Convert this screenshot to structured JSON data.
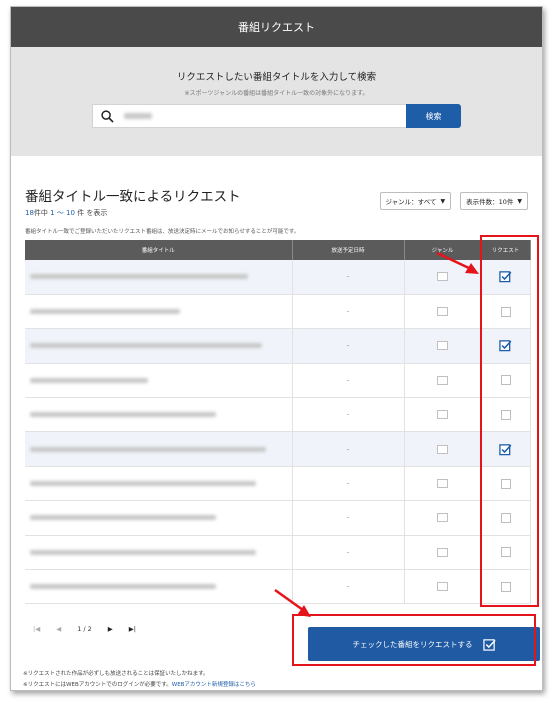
{
  "header": {
    "title": "番組リクエスト"
  },
  "search": {
    "title": "リクエストしたい番組タイトルを入力して検索",
    "note": "※スポーツジャンルの番組は番組タイトル一致の対象外になります。",
    "button_label": "検索"
  },
  "main": {
    "heading": "番組タイトル一致によるリクエスト",
    "count_total": "18",
    "count_suffix": "件中",
    "count_range": "1 〜 10",
    "count_end": "件 を表示",
    "description": "番組タイトル一致でご登録いただいたリクエスト番組は、放送決定時にメールでお知らせすることが可能です。",
    "filter_genre": "ジャンル：すべて",
    "filter_count": "表示件数：10件"
  },
  "table": {
    "columns": [
      "番組タイトル",
      "放送予定日時",
      "ジャンル",
      "リクエスト"
    ],
    "rows": [
      {
        "date": "-",
        "checked": true
      },
      {
        "date": "-",
        "checked": false
      },
      {
        "date": "-",
        "checked": true
      },
      {
        "date": "-",
        "checked": false
      },
      {
        "date": "-",
        "checked": false
      },
      {
        "date": "-",
        "checked": true
      },
      {
        "date": "-",
        "checked": false
      },
      {
        "date": "-",
        "checked": false
      },
      {
        "date": "-",
        "checked": false
      },
      {
        "date": "-",
        "checked": false
      }
    ]
  },
  "pager": {
    "first": "|◀",
    "prev": "◀",
    "page": "1 / 2",
    "next": "▶",
    "last": "▶|"
  },
  "submit": {
    "label": "チェックした番組をリクエストする"
  },
  "notes": {
    "line1": "※リクエストされた作品が必ずしも放送されることは保証いたしかねます。",
    "line2": "※リクエストにはWEBアカウントでのログインが必要です。",
    "link": "WEBアカウント新規登録はこちら"
  },
  "colors": {
    "primary": "#1e5ea8",
    "highlight": "#e4141a",
    "header_bg": "#4a4a4a"
  }
}
